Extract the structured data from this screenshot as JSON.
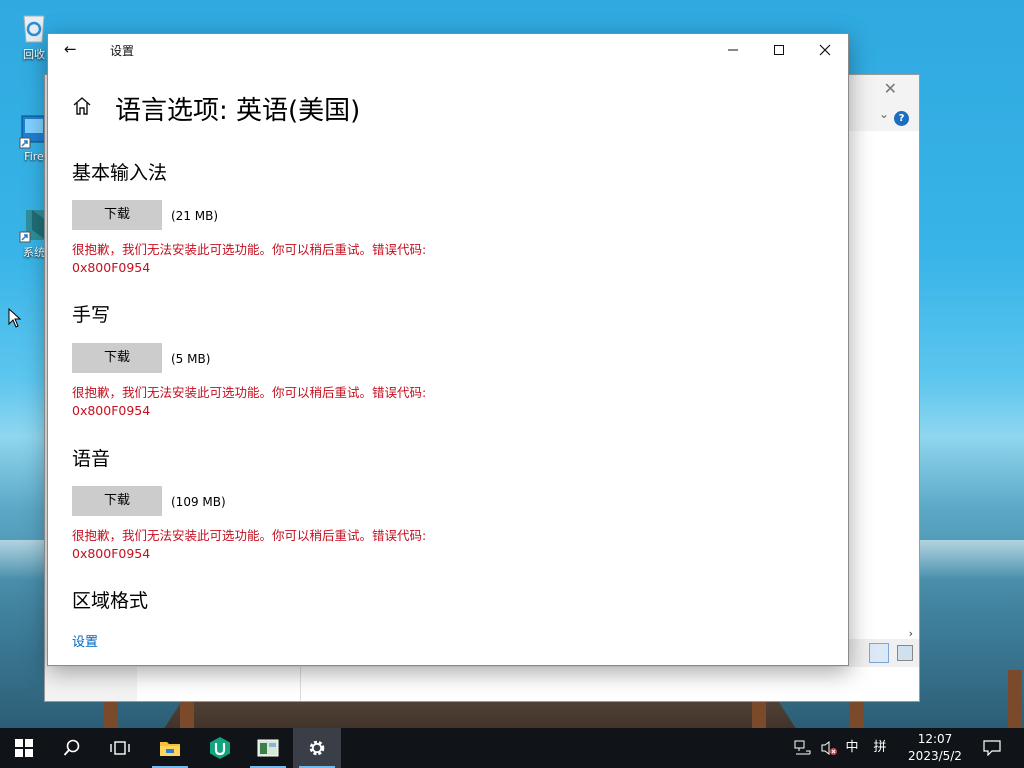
{
  "desktop": {
    "icons": [
      {
        "label": "回收",
        "name": "recycle-bin-icon"
      },
      {
        "label": "Fire",
        "name": "firefox-shortcut-icon"
      },
      {
        "label": "系统",
        "name": "system-shortcut-icon"
      }
    ]
  },
  "settings_window": {
    "title": "设置",
    "page_title": "语言选项: 英语(美国)",
    "sections": [
      {
        "heading": "基本输入法",
        "button": "下载",
        "size": "(21 MB)",
        "error_line1": "很抱歉，我们无法安装此可选功能。你可以稍后重试。错误代码:",
        "error_line2": "0x800F0954"
      },
      {
        "heading": "手写",
        "button": "下载",
        "size": "(5 MB)",
        "error_line1": "很抱歉，我们无法安装此可选功能。你可以稍后重试。错误代码:",
        "error_line2": "0x800F0954"
      },
      {
        "heading": "语音",
        "button": "下载",
        "size": "(109 MB)",
        "error_line1": "很抱歉，我们无法安装此可选功能。你可以稍后重试。错误代码:",
        "error_line2": "0x800F0954"
      }
    ],
    "region_heading": "区域格式",
    "region_link": "设置"
  },
  "taskbar": {
    "ime_mode": "中",
    "ime_layout": "拼",
    "time": "12:07",
    "date": "2023/5/2"
  },
  "colors": {
    "error": "#c50f1f",
    "link": "#0067c0",
    "taskbar": "#101419"
  }
}
